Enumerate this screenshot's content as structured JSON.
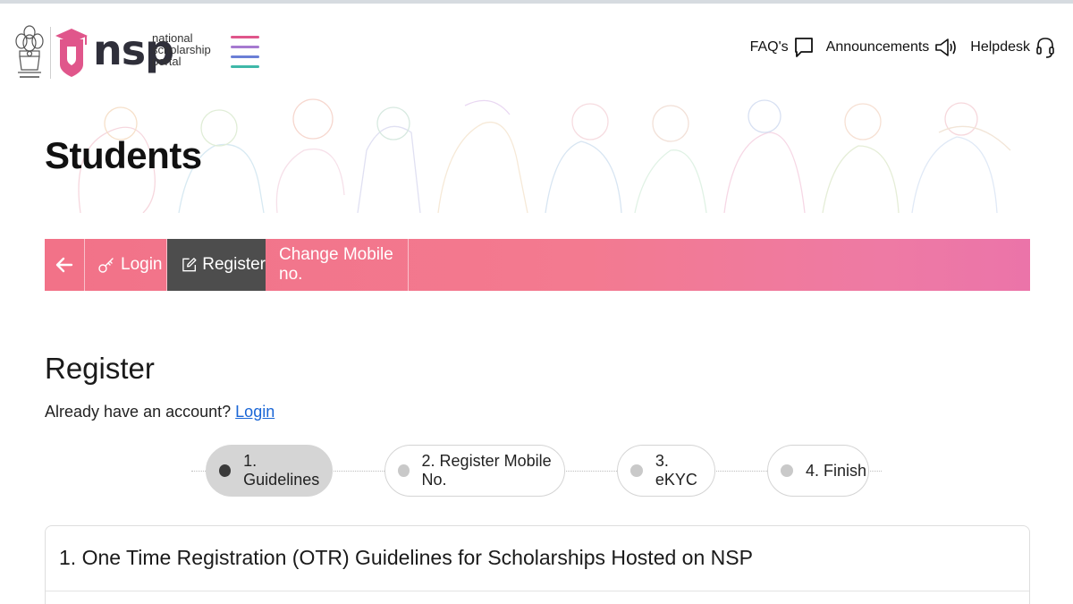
{
  "header": {
    "logo_word": "nsp",
    "logo_sub_lines": [
      "national",
      "scholarship",
      "portal"
    ],
    "nav": [
      {
        "label": "FAQ's",
        "icon": "chat-bubble-icon"
      },
      {
        "label": "Announcements",
        "icon": "megaphone-icon"
      },
      {
        "label": "Helpdesk",
        "icon": "headset-icon"
      }
    ]
  },
  "hero": {
    "title": "Students"
  },
  "tabs": {
    "back_icon": "arrow-left-icon",
    "login": "Login",
    "register": "Register",
    "change_mobile": "Change Mobile no."
  },
  "register": {
    "title": "Register",
    "subtitle_prefix": "Already have an account?",
    "login_link": "Login"
  },
  "stepper": {
    "steps": [
      {
        "label": "1. Guidelines",
        "active": true
      },
      {
        "label": "2. Register Mobile No.",
        "active": false
      },
      {
        "label": "3. eKYC",
        "active": false
      },
      {
        "label": "4. Finish",
        "active": false
      }
    ]
  },
  "guidelines": {
    "title": "1. One Time Registration (OTR) Guidelines for Scholarships Hosted on NSP"
  },
  "colors": {
    "tab_gradient_start": "#f27288",
    "tab_gradient_end": "#eb74a9",
    "active_tab": "#4d4d4d",
    "link": "#1a66d6",
    "logo_pink": "#e0568b"
  }
}
